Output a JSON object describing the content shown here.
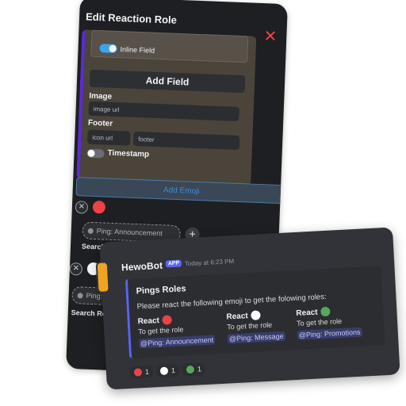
{
  "editor": {
    "title": "Edit Reaction Role",
    "inline_field_label": "Inline Field",
    "add_field_label": "Add Field",
    "image_label": "Image",
    "image_placeholder": "image url",
    "footer_label": "Footer",
    "icon_placeholder": "icon url",
    "footer_placeholder": "footer",
    "timestamp_label": "Timestamp",
    "add_emoji_label": "Add Emoji",
    "role_chip_1": "Ping: Announcement",
    "role_chip_2": "Ping: Me",
    "search_role_label": "Search Role",
    "plus_label": "+",
    "close_label": "✕",
    "remove_label": "✕"
  },
  "message": {
    "bot_name": "HewoBot",
    "badge": "APP",
    "timestamp": "Today at 6:23 PM",
    "embed_title": "Pings Roles",
    "embed_description": "Please react the following emoji to get the folowing roles:",
    "fields": [
      {
        "name": "React",
        "color": "#ed4245",
        "text": "To get the role",
        "role": "@Ping: Announcement"
      },
      {
        "name": "React",
        "color": "#ffffff",
        "text": "To get the role",
        "role": "@Ping: Message"
      },
      {
        "name": "React",
        "color": "#57a85a",
        "text": "To get the role",
        "role": "@Ping: Promotions"
      }
    ],
    "reactions": [
      {
        "color": "#ed4245",
        "count": "1"
      },
      {
        "color": "#ffffff",
        "count": "1"
      },
      {
        "color": "#57a85a",
        "count": "1"
      }
    ]
  },
  "colors": {
    "accent": "#5865f2",
    "danger": "#ed4245",
    "embed_bar": "#5b2bd6"
  }
}
